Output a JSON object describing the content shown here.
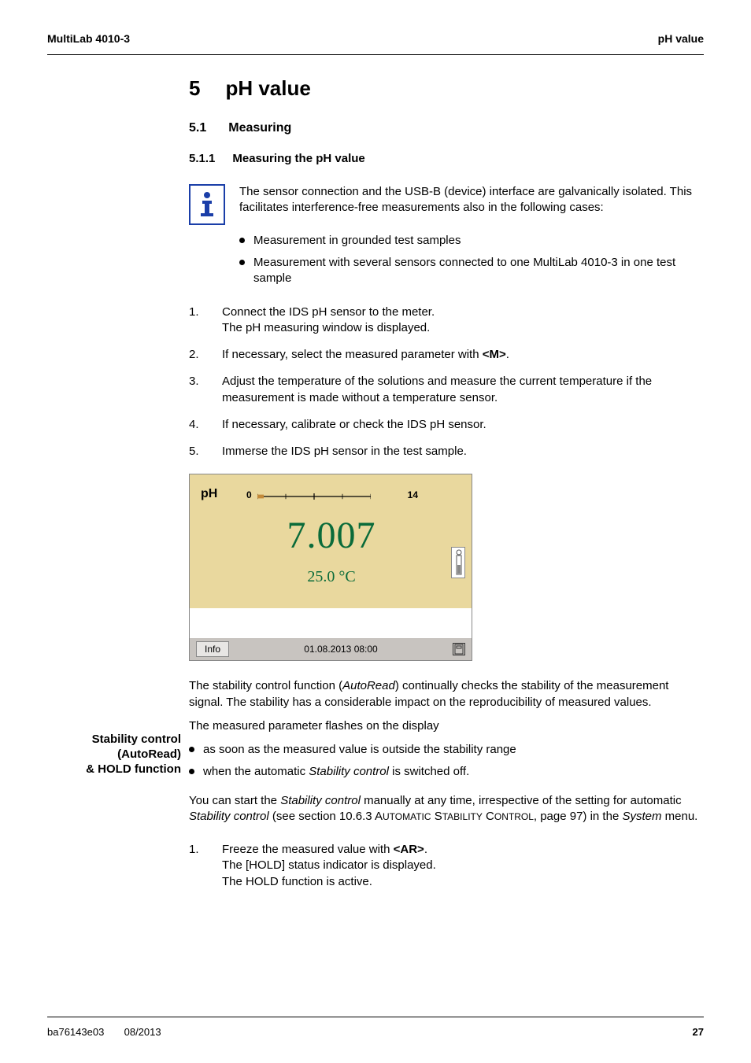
{
  "header": {
    "left": "MultiLab 4010-3",
    "right": "pH value"
  },
  "h1": {
    "num": "5",
    "title": "pH value"
  },
  "h2": {
    "num": "5.1",
    "title": "Measuring"
  },
  "h3": {
    "num": "5.1.1",
    "title": "Measuring the pH value"
  },
  "info_note": "The sensor connection and the USB-B (device) interface are galvanically isolated. This facilitates interference-free measurements also in the following cases:",
  "info_bullets": {
    "b1": "Measurement in grounded test samples",
    "b2": "Measurement with several sensors connected to one MultiLab 4010-3 in one test sample"
  },
  "steps1": {
    "s1": {
      "idx": "1.",
      "txt_a": "Connect the IDS pH sensor to the meter.",
      "txt_b": "The pH measuring window is displayed."
    },
    "s2": {
      "idx": "2.",
      "txt_a": "If necessary, select the measured parameter with ",
      "key": "<M>",
      "txt_b": "."
    },
    "s3": {
      "idx": "3.",
      "txt_a": "Adjust the temperature of the solutions and measure the current temperature if the measurement is made without a temperature sensor."
    },
    "s4": {
      "idx": "4.",
      "txt_a": "If necessary, calibrate or check the IDS pH sensor."
    },
    "s5": {
      "idx": "5.",
      "txt_a": "Immerse the IDS pH sensor in the test sample."
    }
  },
  "device": {
    "ph_label": "pH",
    "scale_min": "0",
    "scale_max": "14",
    "value": "7.007",
    "temp": "25.0 °C",
    "info_btn": "Info",
    "datetime": "01.08.2013 08:00"
  },
  "margin_label": {
    "l1": "Stability control",
    "l2": "(AutoRead)",
    "l3": "& HOLD function"
  },
  "stability": {
    "p1_a": "The stability control function (",
    "p1_i": "AutoRead",
    "p1_b": ") continually checks the stability of the measurement signal. The stability has a considerable impact on the reproducibility of measured values.",
    "p2": "The measured parameter flashes on the display",
    "b1": "as soon as the measured value is outside the stability range",
    "b2_a": "when the automatic ",
    "b2_i": "Stability control",
    "b2_b": " is switched off.",
    "p3_a": "You can start the ",
    "p3_i1": "Stability control",
    "p3_b": " manually at any time, irrespective of the setting for automatic ",
    "p3_i2": "Stability control",
    "p3_c": " (see section 10.6.3 A",
    "p3_sc1": "UTOMATIC",
    "p3_d": " S",
    "p3_sc2": "TABILITY",
    "p3_e": " C",
    "p3_sc3": "ONTROL",
    "p3_f": ", page 97) in the ",
    "p3_i3": "System",
    "p3_g": " menu."
  },
  "steps2": {
    "s1": {
      "idx": "1.",
      "l1_a": "Freeze the measured value with ",
      "l1_key": "<AR>",
      "l1_b": ".",
      "l2": "The [HOLD] status indicator is displayed.",
      "l3": "The HOLD function is active."
    }
  },
  "footer": {
    "left_a": "ba76143e03",
    "left_b": "08/2013",
    "right": "27"
  }
}
